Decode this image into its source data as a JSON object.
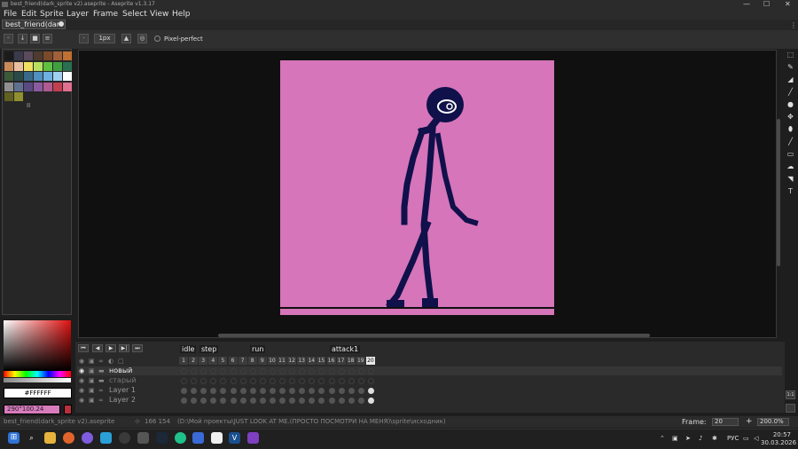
{
  "window": {
    "title": "best_friend(dark_sprite v2).aseprite - Aseprite v1.3.17",
    "minimize": "—",
    "maximize": "☐",
    "close": "✕"
  },
  "menu": [
    "File",
    "Edit",
    "Sprite",
    "Layer",
    "Frame",
    "Select",
    "View",
    "Help"
  ],
  "tab": {
    "label": "best_friend(dar"
  },
  "toolbar": {
    "brush_size": "1px",
    "pixel_perfect": "Pixel-perfect"
  },
  "palette": {
    "colors": [
      "#1b1b1b",
      "#3a3a4a",
      "#5a4a5a",
      "#4e3a30",
      "#7a4a2a",
      "#a0603a",
      "#c07030",
      "#c98a5a",
      "#e8c0a0",
      "#f0e060",
      "#b8e060",
      "#60c040",
      "#40a040",
      "#2a7050",
      "#3a5a3a",
      "#2a4a4a",
      "#3a6a8a",
      "#5090c0",
      "#70b0e0",
      "#a0d0f0",
      "#ffffff",
      "#909090",
      "#607090",
      "#5a4a80",
      "#8a5aa0",
      "#b05a90",
      "#c04050",
      "#e07090",
      "#606020",
      "#909030"
    ],
    "bottom_label": "II"
  },
  "color": {
    "hex": "#FFFFFF",
    "fg_label": "290°100.24"
  },
  "timeline": {
    "playback": [
      "⏮",
      "◀",
      "▶",
      "▶|",
      "⏭"
    ],
    "tags": [
      {
        "label": "idle"
      },
      {
        "label": "step"
      },
      {
        "label": "run"
      },
      {
        "label": "attack1"
      }
    ],
    "frames": [
      "1",
      "2",
      "3",
      "4",
      "5",
      "6",
      "7",
      "8",
      "9",
      "10",
      "11",
      "12",
      "13",
      "14",
      "15",
      "16",
      "17",
      "18",
      "19",
      "20"
    ],
    "layers": [
      {
        "name": "новый",
        "type": "group"
      },
      {
        "name": "старый",
        "type": "group"
      },
      {
        "name": "Layer 1",
        "type": "layer"
      },
      {
        "name": "Layer 2",
        "type": "layer"
      }
    ]
  },
  "status": {
    "file": "best_friend(dark_sprite v2).aseprite",
    "coords": "166 154",
    "path": "(D:\\Мой проекты\\JUST LOOK AT ME.(ПРОСТО ПОСМОТРИ НА МЕНЯ)\\sprite\\исходник)",
    "frame_label": "Frame:",
    "frame_value": "20",
    "zoom": "200.0%"
  },
  "taskbar": {
    "lang": "РУС",
    "time": "20:57",
    "date": "30.03.2026"
  },
  "colors": {
    "canvas_bg": "#d675b9",
    "figure": "#10104a",
    "accent_fg": "#d87bbd"
  }
}
